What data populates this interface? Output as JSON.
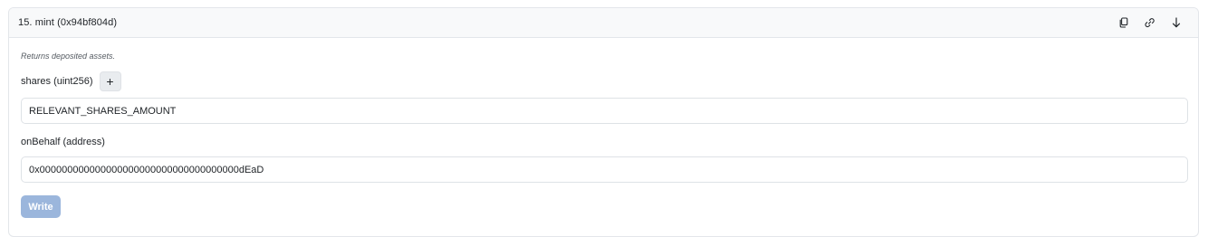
{
  "function": {
    "title": "15. mint (0x94bf804d)",
    "description": "Returns deposited assets."
  },
  "header_actions": [
    {
      "icon": "copy-icon"
    },
    {
      "icon": "link-icon"
    },
    {
      "icon": "arrow-down-icon"
    }
  ],
  "fields": {
    "shares": {
      "label": "shares (uint256)",
      "add_label": "+",
      "value": "RELEVANT_SHARES_AMOUNT"
    },
    "onBehalf": {
      "label": "onBehalf (address)",
      "value": "0x000000000000000000000000000000000000dEaD"
    }
  },
  "write_button": {
    "label": "Write",
    "disabled": true,
    "color": "#9bb6dc"
  }
}
